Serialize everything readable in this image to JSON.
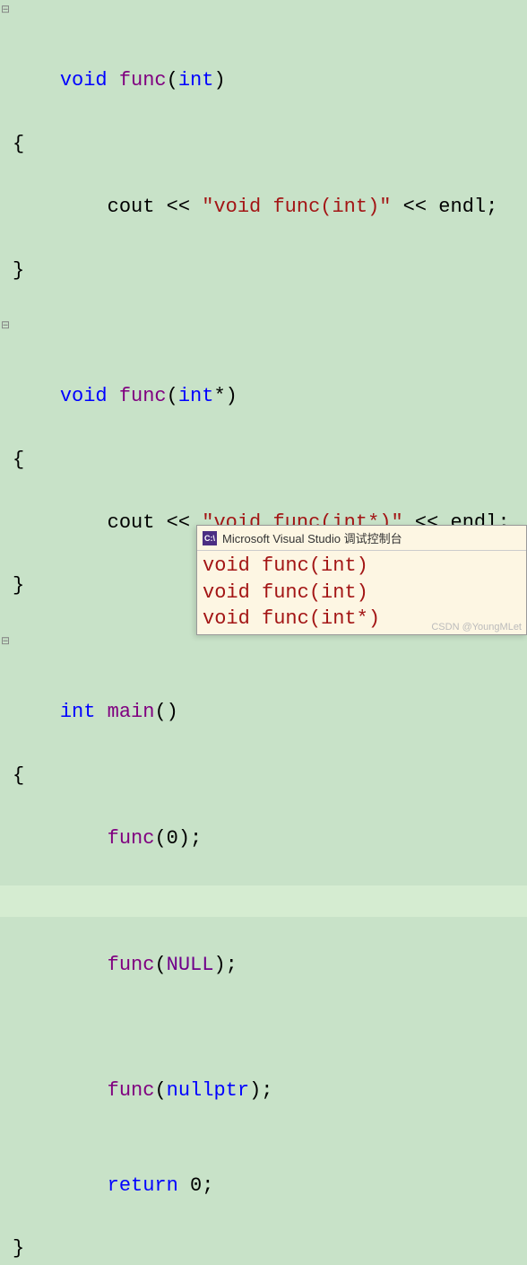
{
  "code": {
    "l1": {
      "kw1": "void",
      "name": " func",
      "paren1": "(",
      "kw2": "int",
      "paren2": ")"
    },
    "l2": "{",
    "l3": {
      "indent": "    ",
      "cout": "cout",
      "op1": " << ",
      "str": "\"void func(int)\"",
      "op2": " << ",
      "endl": "endl",
      "semi": ";"
    },
    "l4": "}",
    "l6": {
      "kw1": "void",
      "name": " func",
      "paren1": "(",
      "kw2": "int",
      "ptr": "*",
      "paren2": ")"
    },
    "l7": "{",
    "l8": {
      "indent": "    ",
      "cout": "cout",
      "op1": " << ",
      "str": "\"void func(int*)\"",
      "op2": " << ",
      "endl": "endl",
      "semi": ";"
    },
    "l9": "}",
    "l11": {
      "kw1": "int",
      "name": " main",
      "paren1": "(",
      "paren2": ")"
    },
    "l12": "{",
    "l13": {
      "indent": "    ",
      "func": "func",
      "paren1": "(",
      "arg": "0",
      "paren2": ")",
      "semi": ";"
    },
    "l15": {
      "indent": "    ",
      "func": "func",
      "paren1": "(",
      "arg": "NULL",
      "paren2": ")",
      "semi": ";"
    },
    "l17": {
      "indent": "    ",
      "func": "func",
      "paren1": "(",
      "arg": "nullptr",
      "paren2": ")",
      "semi": ";"
    },
    "l18": {
      "indent": "    ",
      "kw": "return",
      "sp": " ",
      "val": "0",
      "semi": ";"
    },
    "l19": "}"
  },
  "fold_icon": "⊟",
  "console": {
    "title": "Microsoft Visual Studio 调试控制台",
    "icon_text": "C:\\",
    "lines": [
      "void func(int)",
      "void func(int)",
      "void func(int*)"
    ]
  },
  "watermark": "CSDN @YoungMLet"
}
